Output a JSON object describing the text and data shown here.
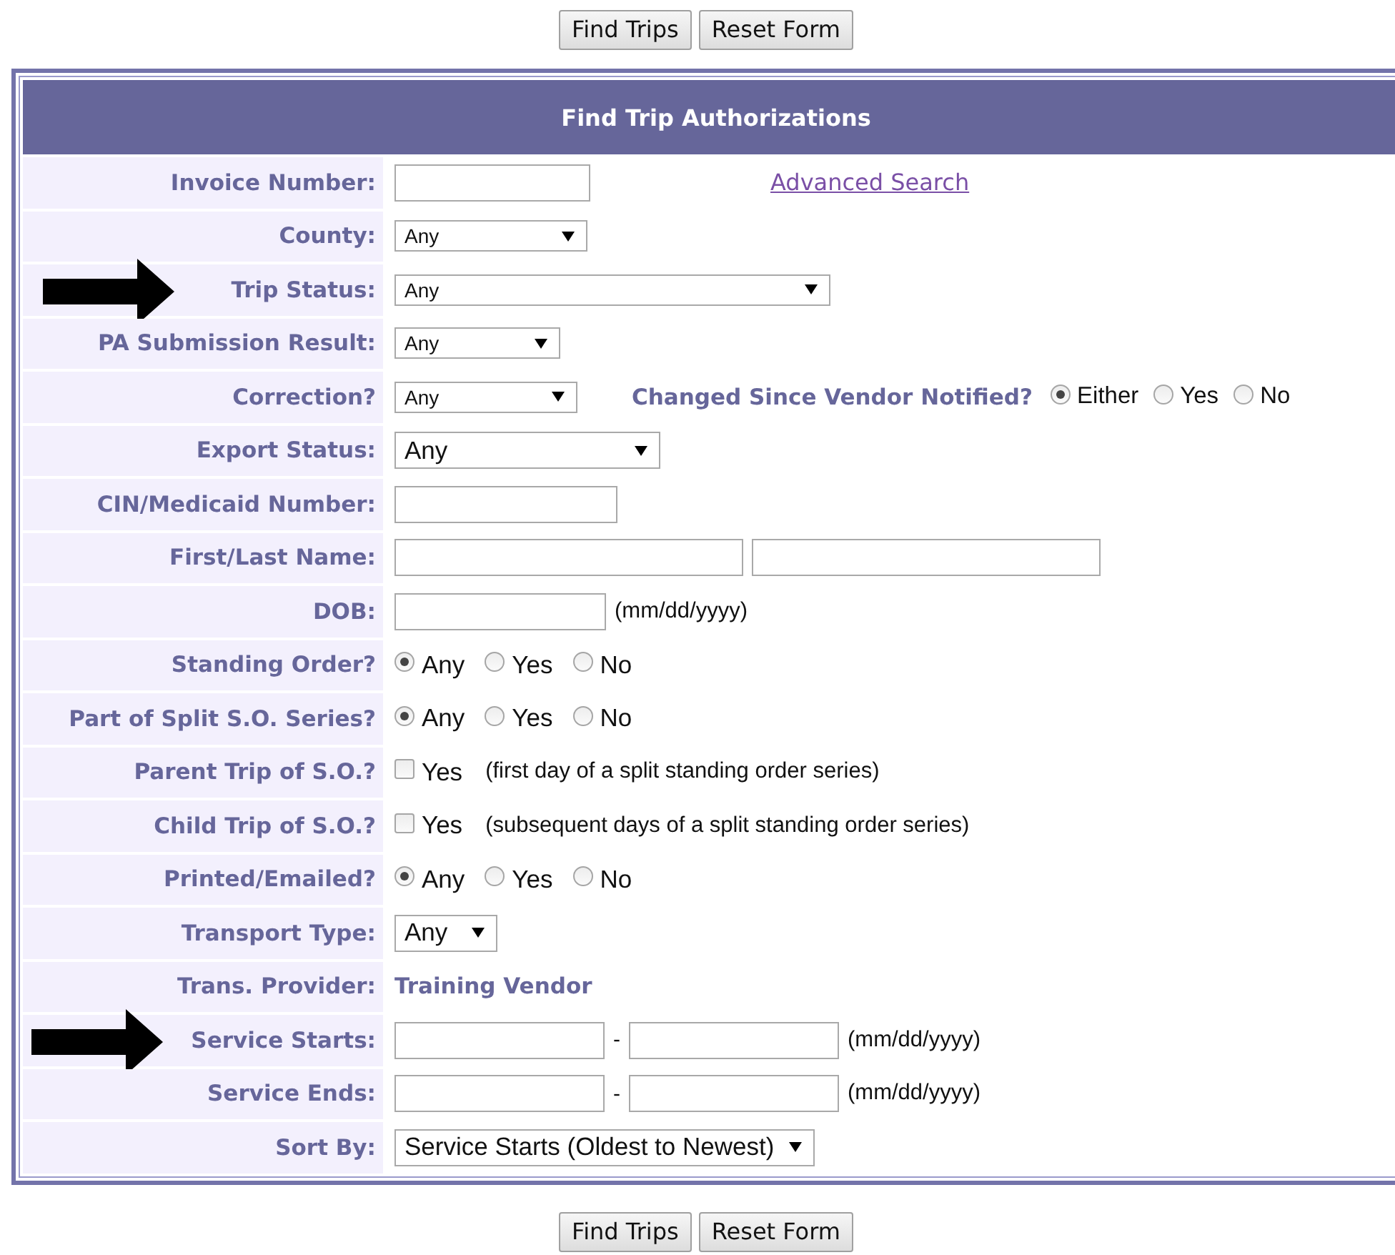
{
  "top_buttons": [
    "Find Trips",
    "Reset Form"
  ],
  "title": "Find Trip Authorizations",
  "rows": [
    {
      "label": "Invoice Number:",
      "arrow": false,
      "controls": [
        {
          "kind": "text"
        },
        {
          "kind": "link",
          "text": "Advanced Search"
        }
      ]
    },
    {
      "label": "County:",
      "arrow": false,
      "controls": [
        {
          "kind": "select",
          "value": "Any"
        }
      ]
    },
    {
      "label": "Trip Status:",
      "arrow": true,
      "controls": [
        {
          "kind": "select",
          "value": "Any"
        }
      ]
    },
    {
      "label": "PA Submission Result:",
      "arrow": false,
      "controls": [
        {
          "kind": "select",
          "value": "Any"
        }
      ]
    },
    {
      "label": "Correction?",
      "arrow": false,
      "controls": [
        {
          "kind": "select",
          "value": "Any"
        },
        {
          "kind": "sublabel",
          "text": "Changed Since Vendor Notified?"
        },
        {
          "kind": "radios",
          "options": [
            {
              "label": "Either",
              "selected": true
            },
            {
              "label": "Yes",
              "selected": false
            },
            {
              "label": "No",
              "selected": false
            }
          ]
        }
      ]
    },
    {
      "label": "Export Status:",
      "arrow": false,
      "controls": [
        {
          "kind": "select",
          "value": "Any"
        }
      ]
    },
    {
      "label": "CIN/Medicaid Number:",
      "arrow": false,
      "controls": [
        {
          "kind": "text"
        }
      ]
    },
    {
      "label": "First/Last Name:",
      "arrow": false,
      "controls": [
        {
          "kind": "text"
        },
        {
          "kind": "text"
        }
      ]
    },
    {
      "label": "DOB:",
      "arrow": false,
      "controls": [
        {
          "kind": "text"
        },
        {
          "kind": "note",
          "text": "(mm/dd/yyyy)"
        }
      ]
    },
    {
      "label": "Standing Order?",
      "arrow": false,
      "controls": [
        {
          "kind": "radios",
          "options": [
            {
              "label": "Any",
              "selected": true
            },
            {
              "label": "Yes",
              "selected": false
            },
            {
              "label": "No",
              "selected": false
            }
          ]
        }
      ]
    },
    {
      "label": "Part of Split S.O. Series?",
      "arrow": false,
      "controls": [
        {
          "kind": "radios",
          "options": [
            {
              "label": "Any",
              "selected": true
            },
            {
              "label": "Yes",
              "selected": false
            },
            {
              "label": "No",
              "selected": false
            }
          ]
        }
      ]
    },
    {
      "label": "Parent Trip of S.O.?",
      "arrow": false,
      "controls": [
        {
          "kind": "checkbox",
          "label": "Yes",
          "checked": false
        },
        {
          "kind": "note",
          "text": "(first day of a split standing order series)"
        }
      ]
    },
    {
      "label": "Child Trip of S.O.?",
      "arrow": false,
      "controls": [
        {
          "kind": "checkbox",
          "label": "Yes",
          "checked": false
        },
        {
          "kind": "note",
          "text": "(subsequent days of a split standing order series)"
        }
      ]
    },
    {
      "label": "Printed/Emailed?",
      "arrow": false,
      "controls": [
        {
          "kind": "radios",
          "options": [
            {
              "label": "Any",
              "selected": true
            },
            {
              "label": "Yes",
              "selected": false
            },
            {
              "label": "No",
              "selected": false
            }
          ]
        }
      ]
    },
    {
      "label": "Transport Type:",
      "arrow": false,
      "controls": [
        {
          "kind": "select",
          "value": "Any"
        }
      ]
    },
    {
      "label": "Trans. Provider:",
      "arrow": false,
      "controls": [
        {
          "kind": "value",
          "text": "Training Vendor"
        }
      ]
    },
    {
      "label": "Service Starts:",
      "arrow": true,
      "controls": [
        {
          "kind": "text"
        },
        {
          "kind": "dash",
          "text": "-"
        },
        {
          "kind": "text"
        },
        {
          "kind": "note",
          "text": "(mm/dd/yyyy)"
        }
      ]
    },
    {
      "label": "Service Ends:",
      "arrow": false,
      "controls": [
        {
          "kind": "text"
        },
        {
          "kind": "dash",
          "text": "-"
        },
        {
          "kind": "text"
        },
        {
          "kind": "note",
          "text": "(mm/dd/yyyy)"
        }
      ]
    },
    {
      "label": "Sort By:",
      "arrow": false,
      "controls": [
        {
          "kind": "select",
          "value": "Service Starts (Oldest to Newest)"
        }
      ]
    }
  ],
  "bottom_buttons": [
    "Find Trips",
    "Reset Form"
  ]
}
